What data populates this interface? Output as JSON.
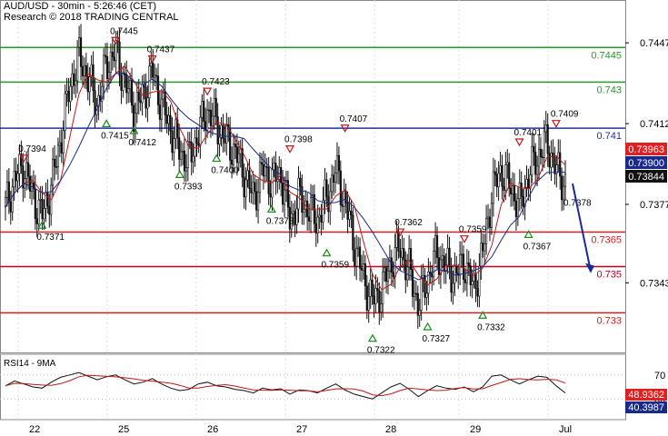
{
  "header": {
    "line1": "AUD/USD - 30min - 5:26:46 (CET)",
    "line2": "Research © 2018 TRADING CENTRAL"
  },
  "rsi": {
    "label": "RSI14 - 9MA",
    "ticks": [
      "70",
      "30"
    ],
    "badge_red": "48.9362",
    "badge_blue": "40.3987"
  },
  "x_ticks": [
    "22",
    "25",
    "26",
    "27",
    "28",
    "29",
    "Jul"
  ],
  "price_ticks": [
    "0.7447",
    "0.7412",
    "0.7377",
    "0.7343"
  ],
  "levels": [
    {
      "label": "0.7445",
      "value": 0.7445,
      "color": "#2a9a2a"
    },
    {
      "label": "0.743",
      "value": 0.743,
      "color": "#2a9a2a"
    },
    {
      "label": "0.741",
      "value": 0.741,
      "color": "#2030a0"
    },
    {
      "label": "0.7365",
      "value": 0.7365,
      "color": "#d02020"
    },
    {
      "label": "0.735",
      "value": 0.735,
      "color": "#c00020"
    },
    {
      "label": "0.733",
      "value": 0.733,
      "color": "#d02020"
    }
  ],
  "price_badges": [
    {
      "label": "0.73963",
      "value": 0.73963,
      "color": "#e02020"
    },
    {
      "label": "0.73900",
      "value": 0.739,
      "color": "#1a2a8a"
    },
    {
      "label": "0.73844",
      "value": 0.73844,
      "color": "#111111"
    }
  ],
  "chart_data": {
    "type": "line",
    "title": "AUD/USD - 30min",
    "ylim": [
      0.7314,
      0.7464
    ],
    "x_categories": [
      "22",
      "25",
      "26",
      "27",
      "28",
      "29",
      "Jul"
    ],
    "close_series": [
      0.7376,
      0.7388,
      0.7394,
      0.738,
      0.7372,
      0.7385,
      0.7405,
      0.7428,
      0.7441,
      0.7432,
      0.742,
      0.7438,
      0.7443,
      0.743,
      0.7418,
      0.7424,
      0.7435,
      0.742,
      0.741,
      0.74,
      0.7396,
      0.7408,
      0.7418,
      0.7412,
      0.7405,
      0.74,
      0.739,
      0.738,
      0.7392,
      0.7387,
      0.739,
      0.737,
      0.738,
      0.7375,
      0.737,
      0.738,
      0.7392,
      0.7378,
      0.736,
      0.7345,
      0.7335,
      0.734,
      0.7352,
      0.7358,
      0.7348,
      0.7333,
      0.7345,
      0.7356,
      0.735,
      0.7346,
      0.7352,
      0.734,
      0.7356,
      0.7382,
      0.7392,
      0.7385,
      0.7376,
      0.739,
      0.7398,
      0.7404,
      0.7392,
      0.7386
    ],
    "peak_labels": [
      {
        "index": 2,
        "value": 0.7394,
        "label": "0.7394"
      },
      {
        "index": 12,
        "value": 0.7445,
        "label": "0.7445"
      },
      {
        "index": 16,
        "value": 0.7437,
        "label": "0.7437"
      },
      {
        "index": 22,
        "value": 0.7423,
        "label": "0.7423"
      },
      {
        "index": 31,
        "value": 0.7398,
        "label": "0.7398"
      },
      {
        "index": 37,
        "value": 0.7407,
        "label": "0.7407"
      },
      {
        "index": 43,
        "value": 0.7362,
        "label": "0.7362"
      },
      {
        "index": 50,
        "value": 0.7359,
        "label": "0.7359"
      },
      {
        "index": 56,
        "value": 0.7401,
        "label": "0.7401"
      },
      {
        "index": 60,
        "value": 0.7409,
        "label": "0.7409"
      }
    ],
    "trough_labels": [
      {
        "index": 4,
        "value": 0.7371,
        "label": "0.7371"
      },
      {
        "index": 11,
        "value": 0.7415,
        "label": "0.7415"
      },
      {
        "index": 14,
        "value": 0.7412,
        "label": "0.7412"
      },
      {
        "index": 19,
        "value": 0.7393,
        "label": "0.7393"
      },
      {
        "index": 23,
        "value": 0.74,
        "label": "0.7400"
      },
      {
        "index": 29,
        "value": 0.7378,
        "label": "0.7378"
      },
      {
        "index": 35,
        "value": 0.7359,
        "label": "0.7359"
      },
      {
        "index": 40,
        "value": 0.7322,
        "label": "0.7322"
      },
      {
        "index": 46,
        "value": 0.7327,
        "label": "0.7327"
      },
      {
        "index": 52,
        "value": 0.7332,
        "label": "0.7332"
      },
      {
        "index": 57,
        "value": 0.7367,
        "label": "0.7367"
      }
    ],
    "plain_labels": [
      {
        "index": 61,
        "value": 0.7378,
        "label": "0.7378"
      }
    ],
    "forecast": {
      "from": 0.7386,
      "to": 0.7348,
      "color": "#1a2a9a"
    },
    "rsi_values": [
      52,
      60,
      55,
      50,
      48,
      58,
      66,
      70,
      74,
      68,
      62,
      67,
      70,
      62,
      55,
      58,
      64,
      55,
      48,
      44,
      46,
      55,
      58,
      52,
      50,
      46,
      44,
      40,
      48,
      45,
      47,
      38,
      45,
      44,
      40,
      48,
      55,
      45,
      38,
      34,
      30,
      40,
      50,
      56,
      46,
      34,
      44,
      52,
      48,
      46,
      50,
      42,
      50,
      68,
      70,
      62,
      55,
      62,
      68,
      66,
      52,
      40
    ],
    "rsi_ylim": [
      0,
      100
    ]
  }
}
